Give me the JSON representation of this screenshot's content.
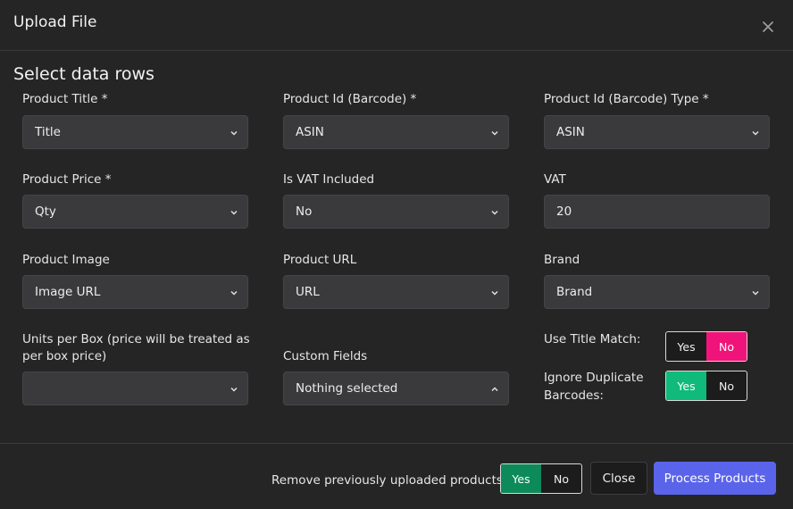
{
  "modal": {
    "title": "Upload File"
  },
  "section": {
    "title": "Select data rows"
  },
  "fields": {
    "product_title": {
      "label": "Product Title *",
      "value": "Title"
    },
    "product_id": {
      "label": "Product Id (Barcode) *",
      "value": "ASIN"
    },
    "product_id_type": {
      "label": "Product Id (Barcode) Type *",
      "value": "ASIN"
    },
    "product_price": {
      "label": "Product Price *",
      "value": "Qty"
    },
    "vat_included": {
      "label": "Is VAT Included",
      "value": "No"
    },
    "vat": {
      "label": "VAT",
      "value": "20"
    },
    "product_image": {
      "label": "Product Image",
      "value": "Image URL"
    },
    "product_url": {
      "label": "Product URL",
      "value": "URL"
    },
    "brand": {
      "label": "Brand",
      "value": "Brand"
    },
    "units_per_box": {
      "label": "Units per Box (price will be treated as per box price)",
      "value": ""
    },
    "custom_fields": {
      "label": "Custom Fields",
      "value": "Nothing selected"
    }
  },
  "toggles": {
    "use_title_match": {
      "label": "Use Title Match:",
      "yes": "Yes",
      "no": "No",
      "selected": "No"
    },
    "ignore_duplicate": {
      "label": "Ignore Duplicate Barcodes:",
      "yes": "Yes",
      "no": "No",
      "selected": "Yes"
    },
    "remove_previous": {
      "label": "Remove previously uploaded products:",
      "yes": "Yes",
      "no": "No",
      "selected": "Yes"
    }
  },
  "footer": {
    "close_label": "Close",
    "process_label": "Process Products"
  },
  "colors": {
    "background": "#252526",
    "input_bg": "#3a3a3c",
    "toggle_no_active": "#f0147a",
    "toggle_yes_active": "#0fba7a",
    "primary_button": "#5a64ea"
  },
  "icons": {
    "close": "close-icon",
    "dropdown": "chevron-down-icon",
    "dropdown_open": "chevron-up-icon"
  }
}
